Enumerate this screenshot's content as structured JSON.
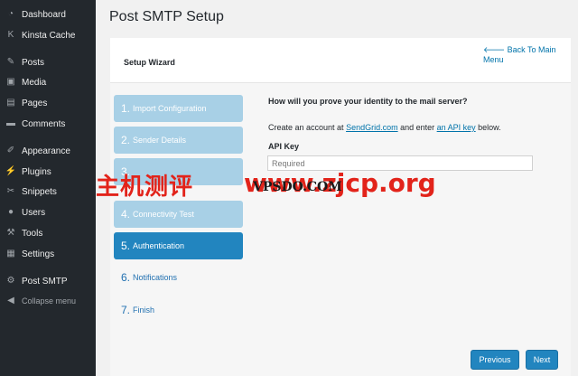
{
  "sidebar": {
    "items": [
      {
        "label": "Dashboard",
        "icon": "dashboard-icon",
        "glyph": "◔"
      },
      {
        "label": "Kinsta Cache",
        "icon": "kinsta-icon",
        "glyph": "K"
      },
      {
        "label": "Posts",
        "icon": "pin-icon",
        "glyph": "✎"
      },
      {
        "label": "Media",
        "icon": "media-icon",
        "glyph": "▣"
      },
      {
        "label": "Pages",
        "icon": "pages-icon",
        "glyph": "▤"
      },
      {
        "label": "Comments",
        "icon": "comments-icon",
        "glyph": "▬"
      },
      {
        "label": "Appearance",
        "icon": "brush-icon",
        "glyph": "✐"
      },
      {
        "label": "Plugins",
        "icon": "plug-icon",
        "glyph": "⚡"
      },
      {
        "label": "Snippets",
        "icon": "scissors-icon",
        "glyph": "✂"
      },
      {
        "label": "Users",
        "icon": "user-icon",
        "glyph": "●"
      },
      {
        "label": "Tools",
        "icon": "wrench-icon",
        "glyph": "⚒"
      },
      {
        "label": "Settings",
        "icon": "settings-icon",
        "glyph": "▦"
      },
      {
        "label": "Post SMTP",
        "icon": "gear-icon",
        "glyph": "⚙"
      }
    ],
    "collapse_label": "Collapse menu",
    "collapse_glyph": "◀"
  },
  "page": {
    "title": "Post SMTP Setup"
  },
  "wizard": {
    "title": "Setup Wizard",
    "back_link": "🡐 Back To Main Menu",
    "steps": [
      {
        "num": "1.",
        "label": "Import Configuration",
        "state": "done"
      },
      {
        "num": "2.",
        "label": "Sender Details",
        "state": "done"
      },
      {
        "num": "3.",
        "label": "",
        "state": "done"
      },
      {
        "num": "4.",
        "label": "Connectivity Test",
        "state": "done"
      },
      {
        "num": "5.",
        "label": "Authentication",
        "state": "active"
      },
      {
        "num": "6.",
        "label": "Notifications",
        "state": "pending"
      },
      {
        "num": "7.",
        "label": "Finish",
        "state": "pending"
      }
    ]
  },
  "auth": {
    "question": "How will you prove your identity to the mail server?",
    "instr_prefix": "Create an account at ",
    "instr_link1": "SendGrid.com",
    "instr_middle": " and enter ",
    "instr_link2": "an API key",
    "instr_suffix": " below.",
    "api_key_label": "API Key",
    "api_key_placeholder": "Required",
    "api_key_value": ""
  },
  "buttons": {
    "previous": "Previous",
    "next": "Next"
  },
  "watermark": {
    "left": "主机测评",
    "right": "www.zjcp.org",
    "logo": "VPSDO.COM"
  },
  "colors": {
    "sidebar_bg": "#23282d",
    "accent": "#2285bf",
    "step_done": "#a8d0e6",
    "link": "#0073aa",
    "watermark": "#e2231a"
  }
}
